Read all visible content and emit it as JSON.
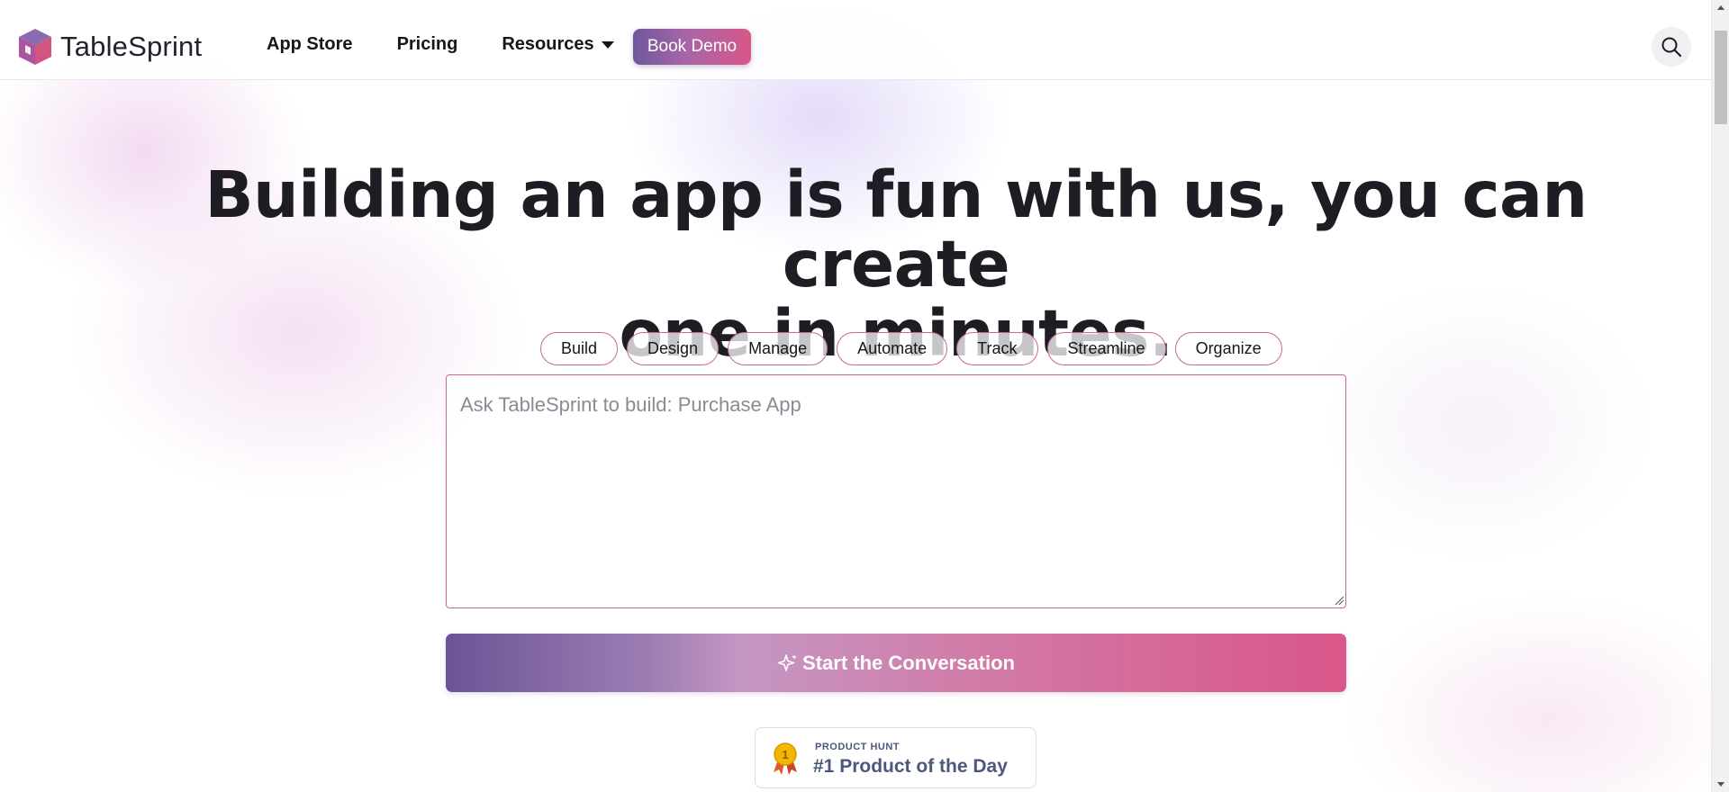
{
  "header": {
    "logo_text": "TableSprint",
    "nav": [
      {
        "label": "App Store"
      },
      {
        "label": "Pricing"
      },
      {
        "label": "Resources",
        "has_dropdown": true
      }
    ],
    "demo_button": "Book Demo",
    "search_icon": "search-icon"
  },
  "hero": {
    "title_line1": "Building an app is fun with us, you can create",
    "title_line2": "one in minutes.",
    "chips": [
      "Build",
      "Design",
      "Manage",
      "Automate",
      "Track",
      "Streamline",
      "Organize"
    ],
    "prompt_placeholder": "Ask TableSprint to build: Purchase App",
    "cta_label": "Start the Conversation",
    "cta_icon": "sparkle-icon"
  },
  "product_hunt": {
    "label": "PRODUCT HUNT",
    "text": "#1 Product of the Day",
    "medal_number": "1"
  },
  "colors": {
    "accent_purple": "#6e589c",
    "accent_pink": "#d85788",
    "chip_border": "#c9679a",
    "product_hunt_text": "#4b587c"
  }
}
